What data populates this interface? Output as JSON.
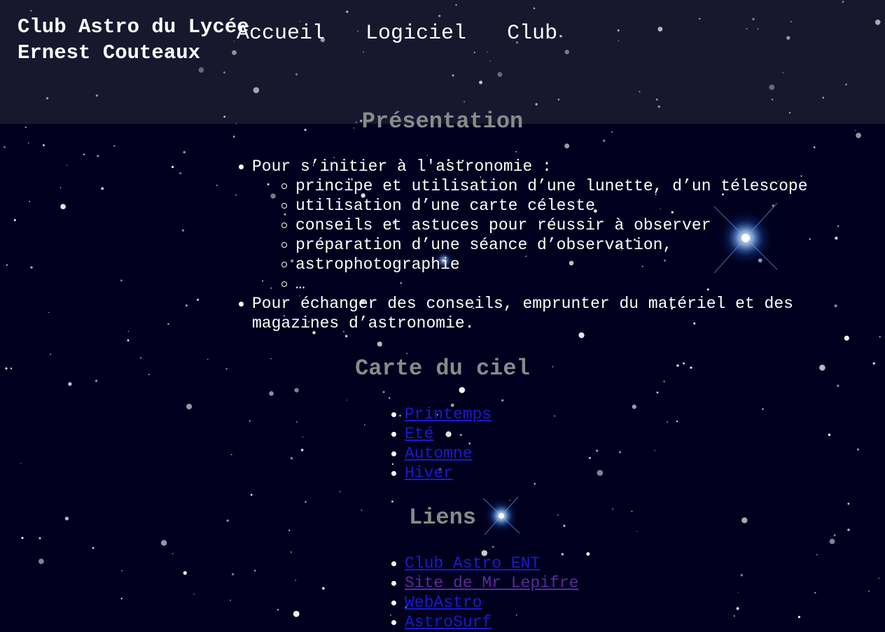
{
  "header": {
    "title": "Club Astro du Lycée Ernest Couteaux"
  },
  "nav": {
    "items": [
      {
        "label": "Accueil"
      },
      {
        "label": "Logiciel"
      },
      {
        "label": "Club"
      }
    ]
  },
  "presentation": {
    "heading": "Présentation",
    "items": [
      {
        "text": "Pour s’initier à l'astronomie :"
      },
      {
        "text": "Pour échanger des conseils, emprunter du matériel et des magazines d’astronomie."
      }
    ],
    "subitems": [
      "principe et utilisation d’une lunette, d’un télescope",
      "utilisation d’une carte céleste",
      "conseils et astuces pour réussir à observer",
      "préparation d’une séance d’observation,",
      "astrophotographie",
      "…"
    ]
  },
  "sky_map": {
    "heading": "Carte du ciel",
    "links": [
      "Printemps",
      "Eté",
      "Automne",
      "Hiver"
    ]
  },
  "links_section": {
    "heading": "Liens",
    "links": [
      "Club Astro ENT",
      "Site de Mr Lepifre",
      "WebAstro",
      "AstroSurf"
    ]
  },
  "colors": {
    "background": "#00001e",
    "heading": "#8a8a8a",
    "link": "#1a1acc",
    "link_visited": "#5a2a9a",
    "text": "#ffffff"
  }
}
